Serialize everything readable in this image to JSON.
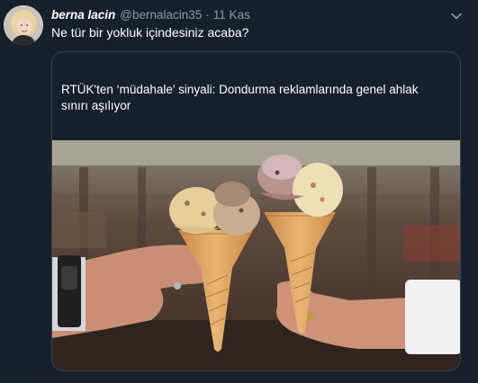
{
  "tweet": {
    "display_name": "berna lacin",
    "handle": "@bernalacin35",
    "separator": "·",
    "time": "11 Kas",
    "text": "Ne tür bir yokluk içindesiniz acaba?",
    "avatar_icon": "user-avatar",
    "menu_icon": "chevron-down-icon"
  },
  "card": {
    "title": "RTÜK'ten ‘müdahale’ sinyali: Dondurma reklamlarında genel ahlak sınırı aşılıyor"
  },
  "colors": {
    "background": "#15202b",
    "secondary_text": "#8899a6",
    "border": "#38444d"
  }
}
